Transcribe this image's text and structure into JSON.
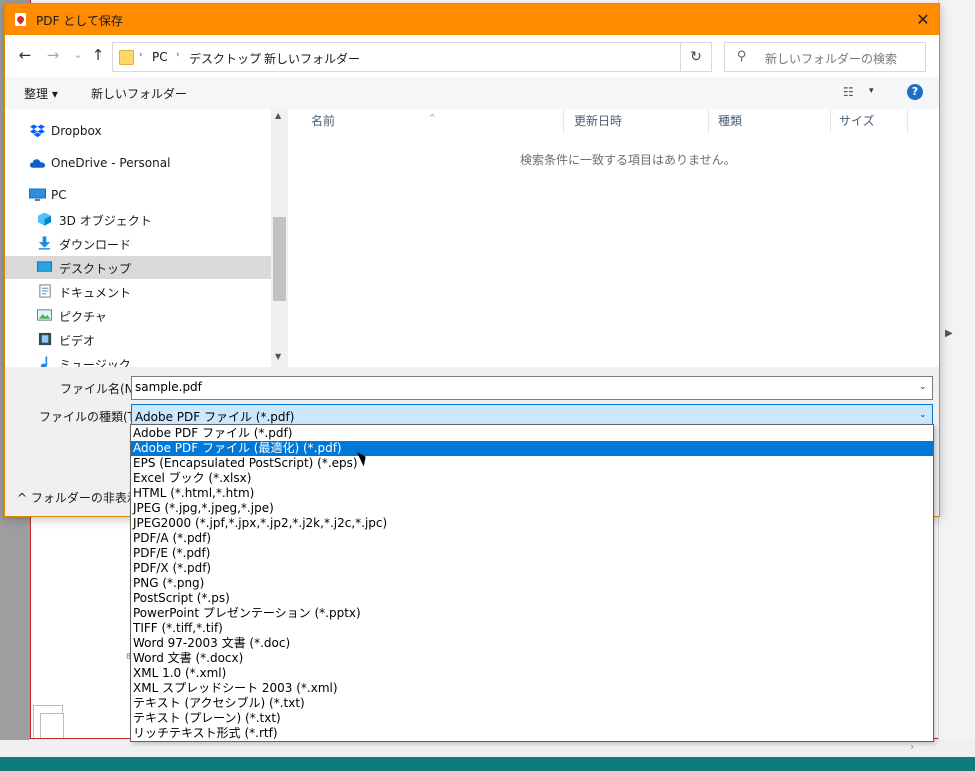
{
  "window": {
    "title": "PDF として保存",
    "close_glyph": "✕"
  },
  "nav": {
    "back_glyph": "←",
    "forward_glyph": "→",
    "recent_glyph": "⌄",
    "up_glyph": "↑",
    "breadcrumb_sep": "›",
    "breadcrumbs": [
      "PC",
      "デスクトップ",
      "新しいフォルダー"
    ],
    "dropdown_glyph": "⌄",
    "refresh_glyph": "↻",
    "search_placeholder": "新しいフォルダーの検索",
    "search_glyph": "⚲"
  },
  "toolbar": {
    "organize_label": "整理 ▾",
    "new_folder_label": "新しいフォルダー",
    "view_glyph": "☷",
    "view_arrow": "▾",
    "help_glyph": "?"
  },
  "tree": {
    "items": [
      {
        "label": "Dropbox",
        "icon": "dropbox-icon"
      },
      {
        "label": "OneDrive - Personal",
        "icon": "cloud-icon"
      },
      {
        "label": "PC",
        "icon": "pc-icon"
      },
      {
        "label": "3D オブジェクト",
        "icon": "cube-icon"
      },
      {
        "label": "ダウンロード",
        "icon": "download-icon"
      },
      {
        "label": "デスクトップ",
        "icon": "desktop-icon",
        "selected": true
      },
      {
        "label": "ドキュメント",
        "icon": "document-icon"
      },
      {
        "label": "ピクチャ",
        "icon": "picture-icon"
      },
      {
        "label": "ビデオ",
        "icon": "video-icon"
      },
      {
        "label": "ミュージック",
        "icon": "music-icon"
      }
    ],
    "scroll_up": "▲",
    "scroll_down": "▼"
  },
  "files": {
    "columns": [
      "名前",
      "更新日時",
      "種類",
      "サイズ"
    ],
    "sort_glyph": "^",
    "empty_message": "検索条件に一致する項目はありません。"
  },
  "form": {
    "filename_label": "ファイル名(N):",
    "filename_value": "sample.pdf",
    "filetype_label": "ファイルの種類(T):",
    "filetype_value": "Adobe PDF ファイル (*.pdf)",
    "dropdown_glyph": "⌄",
    "hide_folders_label": "^ フォルダーの非表示"
  },
  "filetype_options": [
    "Adobe PDF ファイル (*.pdf)",
    "Adobe PDF ファイル (最適化) (*.pdf)",
    "EPS (Encapsulated PostScript) (*.eps)",
    "Excel ブック (*.xlsx)",
    "HTML (*.html,*.htm)",
    "JPEG (*.jpg,*.jpeg,*.jpe)",
    "JPEG2000 (*.jpf,*.jpx,*.jp2,*.j2k,*.j2c,*.jpc)",
    "PDF/A (*.pdf)",
    "PDF/E (*.pdf)",
    "PDF/X (*.pdf)",
    "PNG (*.png)",
    "PostScript (*.ps)",
    "PowerPoint プレゼンテーション (*.pptx)",
    "TIFF (*.tiff,*.tif)",
    "Word 97-2003 文書 (*.doc)",
    "Word 文書 (*.docx)",
    "XML 1.0 (*.xml)",
    "XML スプレッドシート 2003 (*.xml)",
    "テキスト (アクセシブル) (*.txt)",
    "テキスト (プレーン) (*.txt)",
    "リッチテキスト形式 (*.rtf)"
  ],
  "highlighted_option_index": 1,
  "background": {
    "right_arrow": "▶",
    "bottom_arrow": "›",
    "doc_mark": "8"
  },
  "colors": {
    "title_bar": "#ff8c00",
    "accent": "#0078d7",
    "selection": "#cce8ff"
  }
}
